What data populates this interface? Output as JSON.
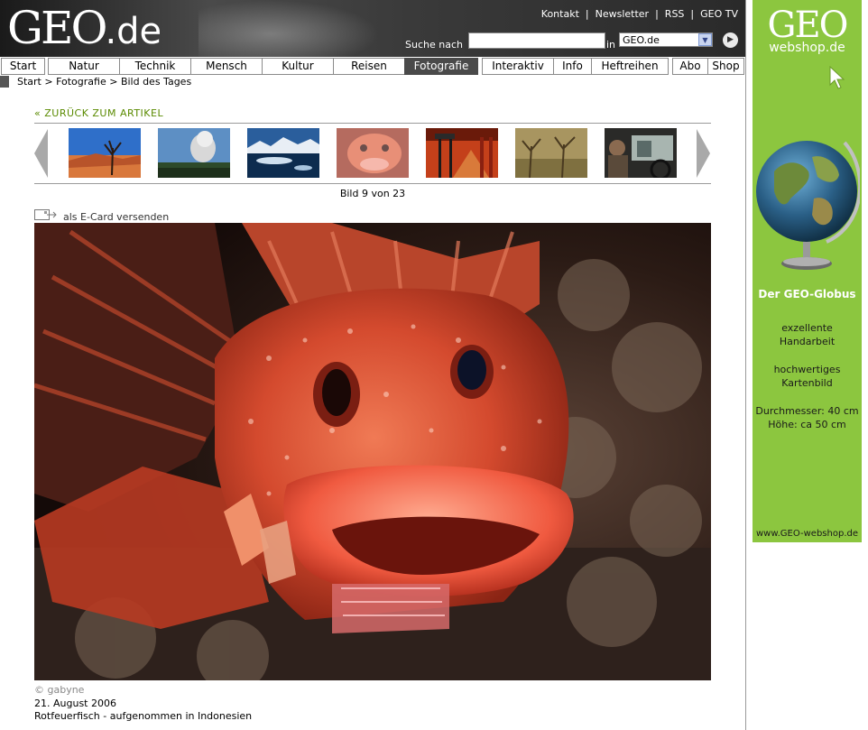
{
  "header": {
    "logo_geo": "GEO",
    "logo_de": ".de",
    "toplinks": [
      "Kontakt",
      "Newsletter",
      "RSS",
      "GEO TV"
    ],
    "search_label": "Suche nach",
    "search_value": "",
    "in_label": "in",
    "scope_selected": "GEO.de"
  },
  "nav": [
    "Start",
    "Natur",
    "Technik",
    "Mensch",
    "Kultur",
    "Reisen",
    "Fotografie",
    "Interaktiv",
    "Info",
    "Heftreihen",
    "Abo",
    "Shop"
  ],
  "nav_active": "Fotografie",
  "breadcrumb": "Start > Fotografie > Bild des Tages",
  "gallery": {
    "back_link": "« ZURÜCK ZUM ARTIKEL",
    "counter": "Bild 9 von 23",
    "ecard": "als E-Card versenden",
    "credit": "© gabyne",
    "date": "21. August 2006",
    "caption": "Rotfeuerfisch - aufgenommen in Indonesien"
  },
  "ad": {
    "brand_geo": "GEO",
    "brand_web": "webshop.de",
    "title": "Der GEO-Globus",
    "line1": "exzellente",
    "line2": "Handarbeit",
    "line3": "hochwertiges",
    "line4": "Kartenbild",
    "line5": "Durchmesser: 40 cm",
    "line6": "Höhe: ca  50 cm",
    "url": "www.GEO-webshop.de"
  },
  "colors": {
    "ad_green": "#8cc63f",
    "link_green": "#5a8a00",
    "nav_active": "#4a4a4a"
  }
}
